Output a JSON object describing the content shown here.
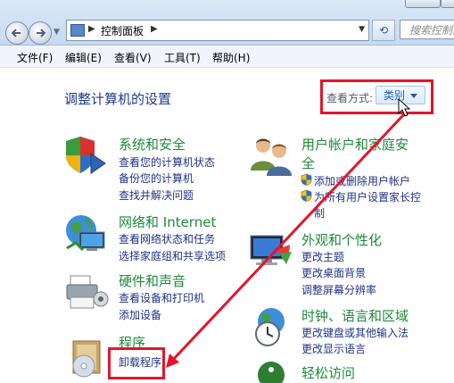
{
  "address_bar": {
    "crumb": "控制面板"
  },
  "search": {
    "placeholder": "搜索控制面板"
  },
  "menu": [
    "文件(F)",
    "编辑(E)",
    "查看(V)",
    "工具(T)",
    "帮助(H)"
  ],
  "page_title": "调整计算机的设置",
  "view_by": {
    "label": "查看方式:",
    "value": "类别"
  },
  "categories": {
    "system_security": {
      "title": "系统和安全",
      "links": [
        "查看您的计算机状态",
        "备份您的计算机",
        "查找并解决问题"
      ]
    },
    "network": {
      "title": "网络和 Internet",
      "links": [
        "查看网络状态和任务",
        "选择家庭组和共享选项"
      ]
    },
    "hardware": {
      "title": "硬件和声音",
      "links": [
        "查看设备和打印机",
        "添加设备"
      ]
    },
    "programs": {
      "title": "程序",
      "links": [
        "卸载程序"
      ]
    },
    "user_accounts": {
      "title_line1": "用户帐户和家庭安",
      "title_line2": "全",
      "links": [
        "添加或删除用户帐户",
        "为所有用户设置家长控",
        "制"
      ]
    },
    "appearance": {
      "title": "外观和个性化",
      "links": [
        "更改主题",
        "更改桌面背景",
        "调整屏幕分辨率"
      ]
    },
    "clock": {
      "title": "时钟、语言和区域",
      "links": [
        "更改键盘或其他输入法",
        "更改显示语言"
      ]
    },
    "ease": {
      "title": "轻松访问"
    }
  },
  "colors": {
    "highlight_box": "#e3152b",
    "category_title": "#1e8a3a",
    "link": "#1e3287"
  }
}
